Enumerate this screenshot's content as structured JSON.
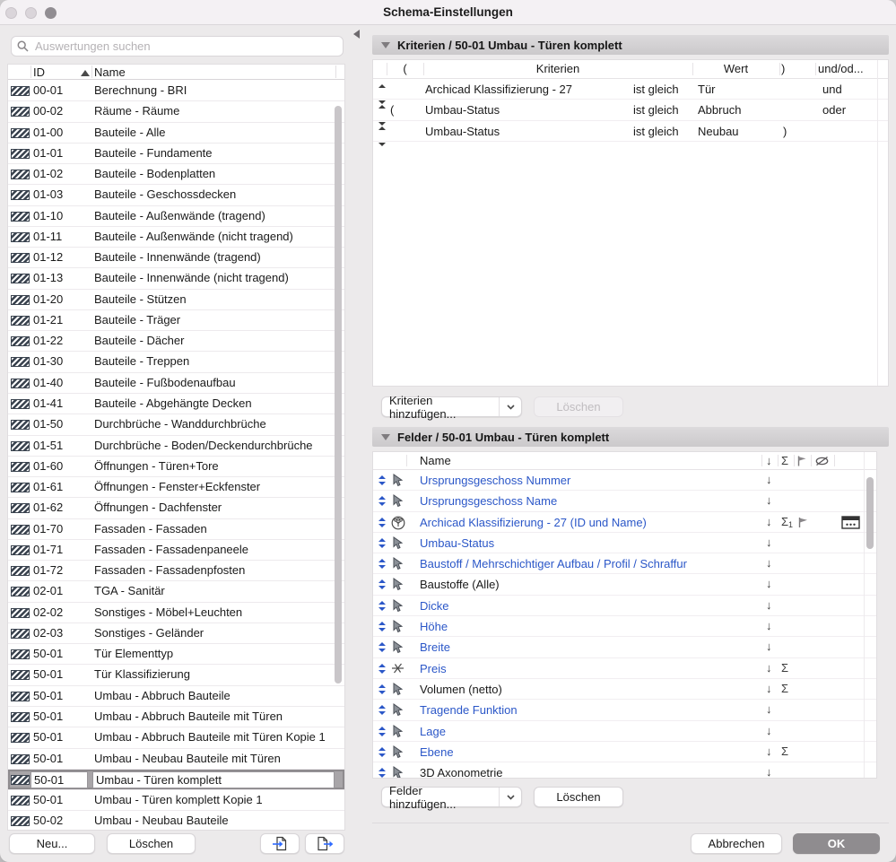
{
  "window": {
    "title": "Schema-Einstellungen"
  },
  "search": {
    "placeholder": "Auswertungen suchen"
  },
  "left_list": {
    "columns": {
      "id": "ID",
      "name": "Name"
    },
    "rows": [
      {
        "id": "00-01",
        "name": "Berechnung - BRI"
      },
      {
        "id": "00-02",
        "name": "Räume - Räume"
      },
      {
        "id": "01-00",
        "name": "Bauteile - Alle"
      },
      {
        "id": "01-01",
        "name": "Bauteile - Fundamente"
      },
      {
        "id": "01-02",
        "name": "Bauteile - Bodenplatten"
      },
      {
        "id": "01-03",
        "name": "Bauteile - Geschossdecken"
      },
      {
        "id": "01-10",
        "name": "Bauteile - Außenwände (tragend)"
      },
      {
        "id": "01-11",
        "name": "Bauteile - Außenwände (nicht tragend)"
      },
      {
        "id": "01-12",
        "name": "Bauteile - Innenwände (tragend)"
      },
      {
        "id": "01-13",
        "name": "Bauteile - Innenwände (nicht tragend)"
      },
      {
        "id": "01-20",
        "name": "Bauteile - Stützen"
      },
      {
        "id": "01-21",
        "name": "Bauteile - Träger"
      },
      {
        "id": "01-22",
        "name": "Bauteile - Dächer"
      },
      {
        "id": "01-30",
        "name": "Bauteile - Treppen"
      },
      {
        "id": "01-40",
        "name": "Bauteile - Fußbodenaufbau"
      },
      {
        "id": "01-41",
        "name": "Bauteile - Abgehängte Decken"
      },
      {
        "id": "01-50",
        "name": "Durchbrüche - Wanddurchbrüche"
      },
      {
        "id": "01-51",
        "name": "Durchbrüche - Boden/Deckendurchbrüche"
      },
      {
        "id": "01-60",
        "name": "Öffnungen - Türen+Tore"
      },
      {
        "id": "01-61",
        "name": "Öffnungen - Fenster+Eckfenster"
      },
      {
        "id": "01-62",
        "name": "Öffnungen - Dachfenster"
      },
      {
        "id": "01-70",
        "name": "Fassaden - Fassaden"
      },
      {
        "id": "01-71",
        "name": "Fassaden - Fassadenpaneele"
      },
      {
        "id": "01-72",
        "name": "Fassaden - Fassadenpfosten"
      },
      {
        "id": "02-01",
        "name": "TGA - Sanitär"
      },
      {
        "id": "02-02",
        "name": "Sonstiges - Möbel+Leuchten"
      },
      {
        "id": "02-03",
        "name": "Sonstiges - Geländer"
      },
      {
        "id": "50-01",
        "name": "Tür Elementtyp"
      },
      {
        "id": "50-01",
        "name": "Tür Klassifizierung"
      },
      {
        "id": "50-01",
        "name": "Umbau - Abbruch Bauteile"
      },
      {
        "id": "50-01",
        "name": "Umbau - Abbruch Bauteile mit Türen"
      },
      {
        "id": "50-01",
        "name": "Umbau - Abbruch Bauteile mit Türen Kopie 1"
      },
      {
        "id": "50-01",
        "name": "Umbau - Neubau Bauteile mit Türen"
      },
      {
        "id": "50-01",
        "name": "Umbau - Türen komplett",
        "selected": true
      },
      {
        "id": "50-01",
        "name": "Umbau - Türen komplett Kopie 1"
      },
      {
        "id": "50-02",
        "name": "Umbau - Neubau Bauteile"
      }
    ],
    "buttons": {
      "new": "Neu...",
      "delete": "Löschen"
    }
  },
  "criteria_panel": {
    "title": "Kriterien / 50-01 Umbau - Türen komplett",
    "columns": {
      "open": "(",
      "criteria": "Kriterien",
      "value": "Wert",
      "close": ")",
      "andor": "und/od..."
    },
    "rows": [
      {
        "open": "",
        "name": "Archicad Klassifizierung - 27",
        "condition": "ist gleich",
        "value": "Tür",
        "close": "",
        "andor": "und"
      },
      {
        "open": "(",
        "name": "Umbau-Status",
        "condition": "ist gleich",
        "value": "Abbruch",
        "close": "",
        "andor": "oder"
      },
      {
        "open": "",
        "name": "Umbau-Status",
        "condition": "ist gleich",
        "value": "Neubau",
        "close": ")",
        "andor": ""
      }
    ],
    "add_button": "Kriterien hinzufügen...",
    "delete_button": "Löschen"
  },
  "fields_panel": {
    "title": "Felder / 50-01 Umbau - Türen komplett",
    "name_column": "Name",
    "rows": [
      {
        "name": "Ursprungsgeschoss Nummer",
        "icon": "parameter",
        "link": true,
        "sort": true
      },
      {
        "name": "Ursprungsgeschoss Name",
        "icon": "parameter",
        "link": true,
        "sort": true
      },
      {
        "name": "Archicad Klassifizierung - 27 (ID und Name)",
        "icon": "classification",
        "link": true,
        "sort": true,
        "sum1": true,
        "flag": true,
        "options": true
      },
      {
        "name": "Umbau-Status",
        "icon": "parameter",
        "link": true,
        "sort": true
      },
      {
        "name": "Baustoff / Mehrschichtiger Aufbau / Profil / Schraffur",
        "icon": "parameter",
        "link": true,
        "sort": true
      },
      {
        "name": "Baustoffe (Alle)",
        "icon": "parameter",
        "link": false,
        "sort": true
      },
      {
        "name": "Dicke",
        "icon": "parameter",
        "link": true,
        "sort": true
      },
      {
        "name": "Höhe",
        "icon": "parameter",
        "link": true,
        "sort": true
      },
      {
        "name": "Breite",
        "icon": "parameter",
        "link": true,
        "sort": true
      },
      {
        "name": "Preis",
        "icon": "expression",
        "link": true,
        "sort": true,
        "sum": true
      },
      {
        "name": "Volumen (netto)",
        "icon": "parameter",
        "link": false,
        "sort": true,
        "sum": true
      },
      {
        "name": "Tragende Funktion",
        "icon": "parameter",
        "link": true,
        "sort": true
      },
      {
        "name": "Lage",
        "icon": "parameter",
        "link": true,
        "sort": true
      },
      {
        "name": "Ebene",
        "icon": "parameter",
        "link": true,
        "sort": true,
        "sum": true
      },
      {
        "name": "3D Axonometrie",
        "icon": "parameter",
        "link": false,
        "sort": true
      }
    ],
    "add_button": "Felder hinzufügen...",
    "delete_button": "Löschen"
  },
  "footer": {
    "cancel": "Abbrechen",
    "ok": "OK"
  },
  "colors": {
    "link_blue": "#2B57C8",
    "arrow_blue": "#2F6BFF",
    "ok_button_bg": "#8F8C8F"
  }
}
